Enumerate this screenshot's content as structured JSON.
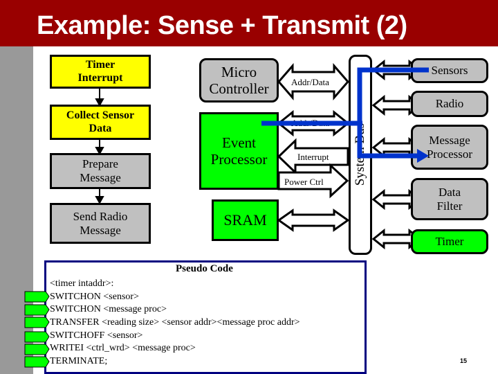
{
  "slide": {
    "title": "Example: Sense + Transmit (2)",
    "page_number": "15"
  },
  "flowchart": {
    "steps": [
      {
        "label": "Timer Interrupt",
        "color": "#ffff00"
      },
      {
        "label": "Collect Sensor Data",
        "color": "#ffff00"
      },
      {
        "label": "Prepare Message",
        "color": "#c0c0c0"
      },
      {
        "label": "Send Radio Message",
        "color": "#c0c0c0"
      }
    ]
  },
  "architecture": {
    "micro_controller": "Micro Controller",
    "event_processor": "Event Processor",
    "sram": "SRAM",
    "system_bus": "System Bus",
    "arrow_labels": {
      "mc_addr_data": "Addr/Data",
      "ep_addr_data": "Addr/Data",
      "interrupt": "Interrupt",
      "power_ctrl": "Power Ctrl"
    },
    "peripherals": [
      {
        "label": "Sensors",
        "color": "#c0c0c0"
      },
      {
        "label": "Radio",
        "color": "#c0c0c0"
      },
      {
        "label": "Message Processor",
        "color": "#c0c0c0"
      },
      {
        "label": "Data Filter",
        "color": "#c0c0c0"
      },
      {
        "label": "Timer",
        "color": "#00ff00"
      }
    ],
    "highlight_path_color": "#0033cc"
  },
  "pseudo_code": {
    "title": "Pseudo Code",
    "lines": [
      "<timer intaddr>:",
      "SWITCHON <sensor>",
      "SWITCHON <message proc>",
      "TRANSFER <reading size> <sensor addr><message proc addr>",
      "SWITCHOFF <sensor>",
      "WRITEI <ctrl_wrd> <message proc>",
      "TERMINATE;"
    ]
  }
}
